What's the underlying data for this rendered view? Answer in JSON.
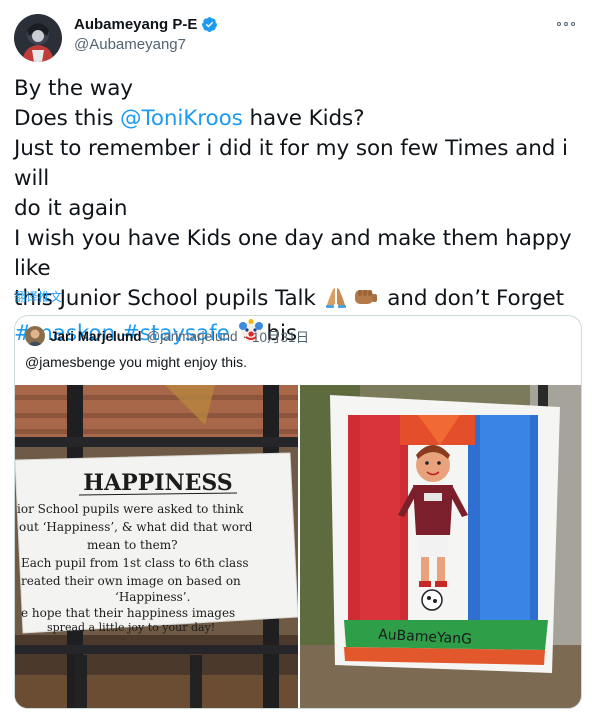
{
  "author": {
    "display_name": "Aubameyang P-E",
    "handle": "@Aubameyang7",
    "avatar_icon": "profile-avatar",
    "verified_icon": "verified-badge-icon",
    "verified_color": "#1d9bf0"
  },
  "more_icon": "more-options-icon",
  "tweet": {
    "line1": "By the way",
    "line2_pre": "Does this ",
    "line2_mention": "@ToniKroos",
    "line2_post": " have Kids?",
    "line3": "Just to remember i did it for my son few Times and i will",
    "line4": "do it again",
    "line5": "I wish you have Kids one day and make them happy like",
    "line6_pre": "this Junior School pupils Talk ",
    "line6_post": " and don’t Forget",
    "hashtag1": "#maskon",
    "hashtag2": "#staysafe",
    "line7_post": "bis",
    "emojis": [
      "folded-hands-emoji",
      "fist-bump-emoji",
      "clown-face-emoji"
    ]
  },
  "translate_label": "翻译推文",
  "quote": {
    "name": "Jari Marjelund",
    "handle": "@jarimarjelund",
    "separator": "·",
    "date": "10月31日",
    "text": "@jamesbenge you might enjoy this.",
    "sign": {
      "title": "HAPPINESS",
      "lines": [
        "ior School pupils were asked to think",
        "out ‘Happiness’, & what did that word",
        "mean to them?",
        "Each pupil from 1st class to 6th class",
        "reated their own image on based on",
        "‘Happiness’.",
        "e hope that their happiness images",
        "spread a little joy to your day!"
      ]
    },
    "drawing_caption": "AuBameYanG"
  },
  "colors": {
    "accent": "#1d9bf0",
    "text": "#0f1419",
    "secondary": "#536471",
    "border": "#cfd9de"
  }
}
